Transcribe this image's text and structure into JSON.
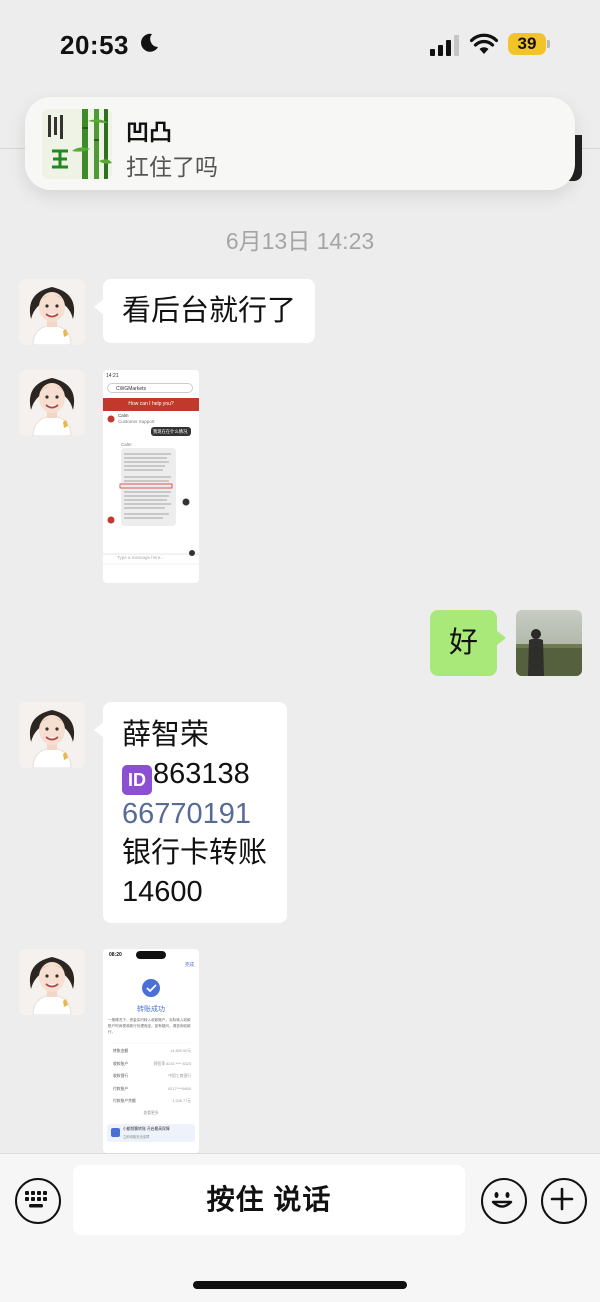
{
  "status_bar": {
    "time": "20:53",
    "battery": "39"
  },
  "notification": {
    "title": "凹凸",
    "body": "扛住了吗"
  },
  "timestamp": "6月13日 14:23",
  "messages": {
    "m1": "看后台就行了",
    "m3": "好",
    "m4": {
      "line1": "薛智荣",
      "id_glyph": "ID",
      "line2": "863138",
      "line3": "66770191",
      "line4": "银行卡转账",
      "line5": "14600"
    }
  },
  "screenshot1": {
    "time": "14:21",
    "site": "CWGMarkets",
    "banner": "How can I help you?",
    "agent_name": "Calm",
    "agent_role": "Customer Support",
    "user_msg": "我现在在什么情况",
    "agent_sub": "Calm",
    "placeholder": "Type a message here..."
  },
  "screenshot2": {
    "time": "08:20",
    "done": "完成",
    "title": "转账成功",
    "note": "一般情况下，资金实时转入收款账户。实际转入收款账户时间视收款行处理而定。如有疑问，请咨询收款行。",
    "rows": [
      {
        "label": "转账金额",
        "value": "14,600.00元"
      },
      {
        "label": "收款账户",
        "value": "薛智荣 6215 **** 8323"
      },
      {
        "label": "收款银行",
        "value": "中国工商银行"
      },
      {
        "label": "付款账户",
        "value": "6217****6800"
      },
      {
        "label": "付款账户余额",
        "value": "1,026.77元"
      }
    ],
    "more": "查看更多",
    "promo": "小额频繁转账 开启最高保障",
    "promo_sub": "立即领取安全保障"
  },
  "input_bar": {
    "hold_to_talk": "按住 说话"
  },
  "colors": {
    "background": "#ededed",
    "self_bubble": "#a9e97a",
    "link": "#576b95",
    "battery": "#f3c428"
  }
}
